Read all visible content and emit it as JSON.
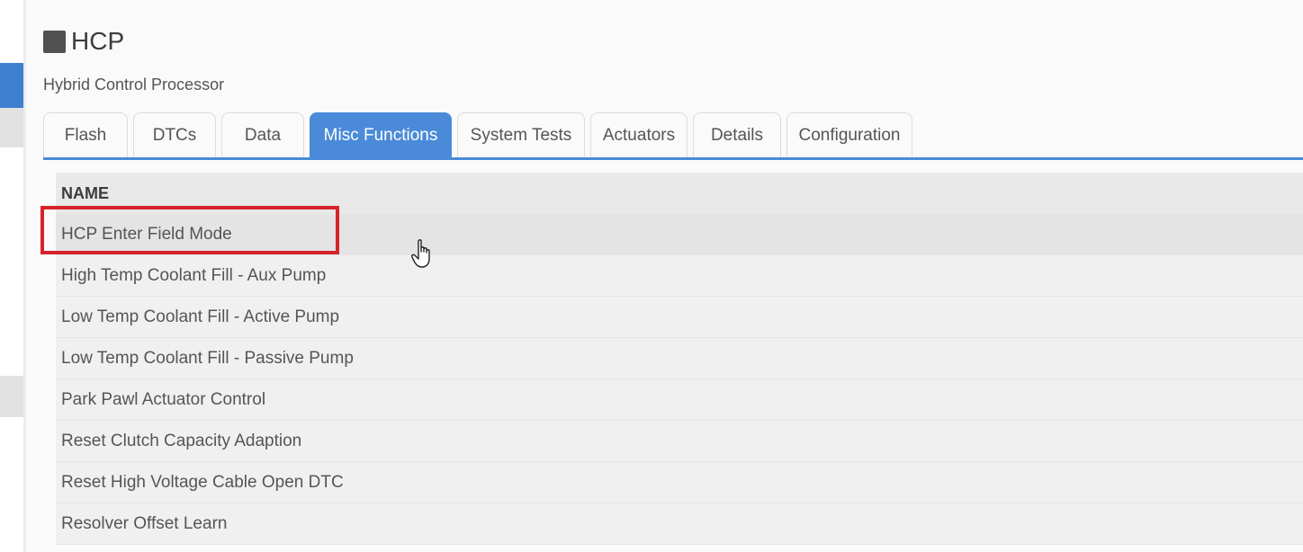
{
  "header": {
    "title": "HCP",
    "subtitle": "Hybrid Control Processor",
    "icon": "square-icon"
  },
  "tabs": [
    {
      "label": "Flash",
      "active": false
    },
    {
      "label": "DTCs",
      "active": false
    },
    {
      "label": "Data",
      "active": false
    },
    {
      "label": "Misc Functions",
      "active": true
    },
    {
      "label": "System Tests",
      "active": false
    },
    {
      "label": "Actuators",
      "active": false
    },
    {
      "label": "Details",
      "active": false
    },
    {
      "label": "Configuration",
      "active": false
    }
  ],
  "table": {
    "column_header": "NAME",
    "rows": [
      "HCP Enter Field Mode",
      "High Temp Coolant Fill - Aux Pump",
      "Low Temp Coolant Fill - Active Pump",
      "Low Temp Coolant Fill - Passive Pump",
      "Park Pawl Actuator Control",
      "Reset Clutch Capacity Adaption",
      "Reset High Voltage Cable Open DTC",
      "Resolver Offset Learn"
    ],
    "highlighted_row": "HCP Enter Field Mode"
  },
  "colors": {
    "accent": "#4a8ad8",
    "highlight": "#d4242a",
    "icon": "#505050"
  },
  "cursor": "hand-pointer-icon"
}
